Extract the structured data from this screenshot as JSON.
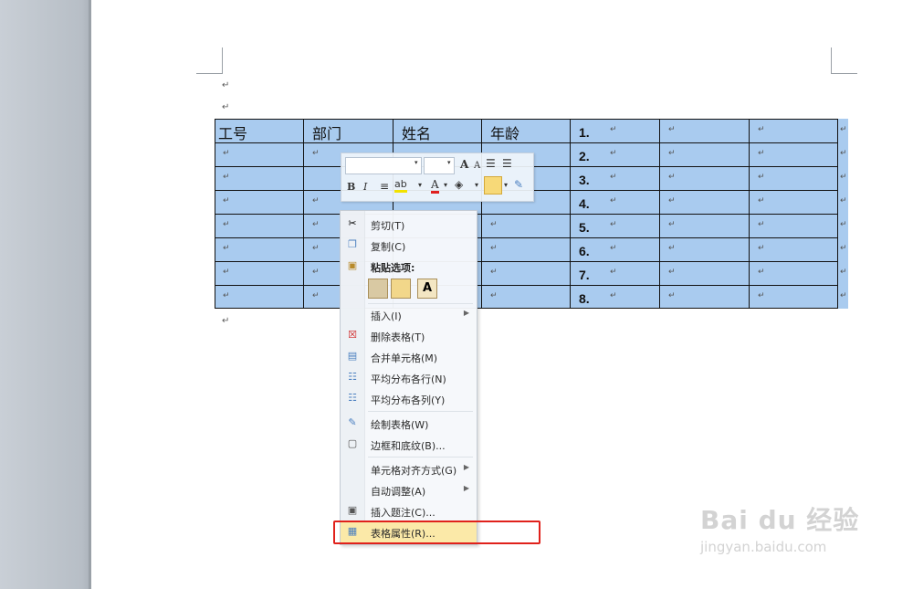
{
  "table": {
    "headers": [
      "工号",
      "部门",
      "姓名",
      "年龄"
    ],
    "cell_mark": "↵",
    "numbered": [
      "1.",
      "2.",
      "3.",
      "4.",
      "5.",
      "6.",
      "7.",
      "8."
    ]
  },
  "mini_toolbar": {
    "grow_font": "A",
    "shrink_font": "A",
    "bold": "B",
    "italic": "I",
    "font_color": "A"
  },
  "context_menu": {
    "items": [
      {
        "label": "剪切(T)",
        "icon": "scissors-icon"
      },
      {
        "label": "复制(C)",
        "icon": "copy-icon"
      },
      {
        "label": "粘贴选项:",
        "icon": "paste-icon"
      },
      {
        "label": "插入(I)",
        "icon": "none",
        "submenu": true
      },
      {
        "label": "删除表格(T)",
        "icon": "delete-table-icon"
      },
      {
        "label": "合并单元格(M)",
        "icon": "merge-cells-icon"
      },
      {
        "label": "平均分布各行(N)",
        "icon": "distribute-rows-icon"
      },
      {
        "label": "平均分布各列(Y)",
        "icon": "distribute-columns-icon"
      },
      {
        "label": "绘制表格(W)",
        "icon": "draw-table-icon"
      },
      {
        "label": "边框和底纹(B)...",
        "icon": "borders-icon"
      },
      {
        "label": "单元格对齐方式(G)",
        "icon": "none",
        "submenu": true
      },
      {
        "label": "自动调整(A)",
        "icon": "none",
        "submenu": true
      },
      {
        "label": "插入题注(C)...",
        "icon": "caption-icon"
      },
      {
        "label": "表格属性(R)...",
        "icon": "table-properties-icon",
        "highlighted": true
      }
    ],
    "paste_option_letter": "A"
  },
  "watermark": {
    "brand": "Bai du 经验",
    "url": "jingyan.baidu.com"
  },
  "colors": {
    "selection": "#a9cbef",
    "highlight": "#fbe9a8",
    "callout_border": "#e0211b"
  }
}
